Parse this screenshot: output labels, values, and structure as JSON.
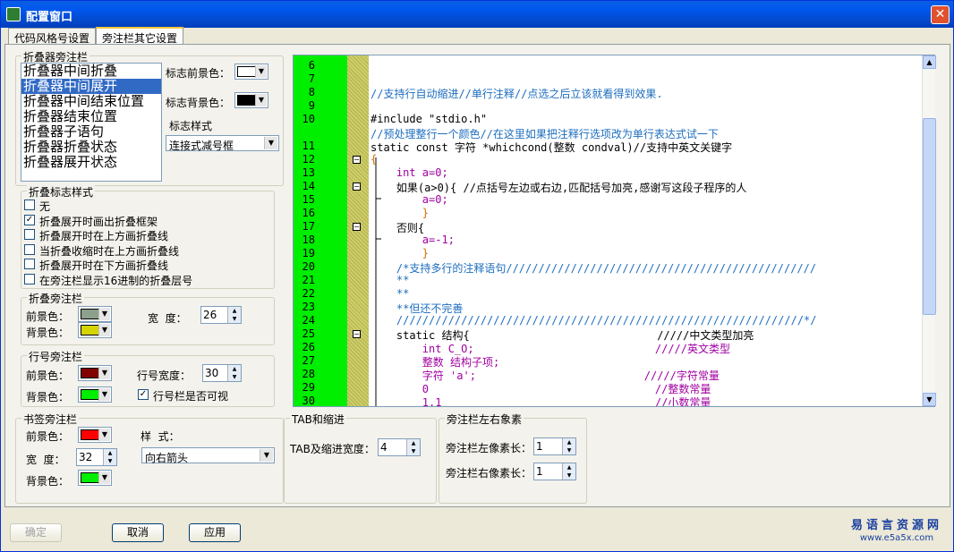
{
  "window": {
    "title": "配置窗口"
  },
  "tabs": [
    "代码风格号设置",
    "旁注栏其它设置"
  ],
  "fold_sidebar": {
    "title": "折叠器旁注栏",
    "items": [
      "折叠器中间折叠",
      "折叠器中间展开",
      "折叠器中间结束位置",
      "折叠器结束位置",
      "折叠器子语句",
      "折叠器折叠状态",
      "折叠器展开状态"
    ],
    "selected": 1,
    "fg_label": "标志前景色：",
    "bg_label": "标志背景色：",
    "style_label": "标志样式",
    "style_value": "连接式减号框",
    "fg_color": "#ffffff",
    "bg_color": "#000000"
  },
  "fold_flag_style": {
    "title": "折叠标志样式",
    "options": [
      {
        "label": "无",
        "checked": false
      },
      {
        "label": "折叠展开时画出折叠框架",
        "checked": true
      },
      {
        "label": "折叠展开时在上方画折叠线",
        "checked": false
      },
      {
        "label": "当折叠收缩时在上方画折叠线",
        "checked": false
      },
      {
        "label": "折叠展开时在下方画折叠线",
        "checked": false
      },
      {
        "label": "在旁注栏显示16进制的折叠层号",
        "checked": false
      }
    ]
  },
  "fold_margin": {
    "title": "折叠旁注栏",
    "fg_label": "前景色：",
    "bg_label": "背景色：",
    "width_label": "宽  度：",
    "width": "26",
    "fg_color": "#8ca08c",
    "bg_color": "#d4d400"
  },
  "line_margin": {
    "title": "行号旁注栏",
    "fg_label": "前景色：",
    "bg_label": "背景色：",
    "width_label": "行号宽度：",
    "width": "30",
    "visible_label": "行号栏是否可视",
    "visible": true,
    "fg_color": "#800000",
    "bg_color": "#00ee00"
  },
  "bookmark_margin": {
    "title": "书签旁注栏",
    "fg_label": "前景色：",
    "width_label": "宽  度：",
    "width": "32",
    "bg_label": "背景色：",
    "style_label": "样  式：",
    "style_value": "向右箭头",
    "fg_color": "#ff0000",
    "bg_color": "#00ee00"
  },
  "tab_indent": {
    "title": "TAB和缩进",
    "width_label": "TAB及缩进宽度：",
    "width": "4"
  },
  "margin_pixels": {
    "title": "旁注栏左右象素",
    "left_label": "旁注栏左像素长：",
    "left": "1",
    "right_label": "旁注栏右像素长：",
    "right": "1"
  },
  "code_lines": [
    {
      "n": "6",
      "t": ""
    },
    {
      "n": "7",
      "t": ""
    },
    {
      "n": "8",
      "t": "//支持行自动缩进//单行注释//点选之后立该就看得到效果."
    },
    {
      "n": "9",
      "t": ""
    },
    {
      "n": "10",
      "t": "#include \"stdio.h\""
    },
    {
      "n": "",
      "t": "//预处理整行一个颜色//在这里如果把注释行选项改为单行表达式试一下"
    },
    {
      "n": "11",
      "t": "static const 字符 *whichcond(整数 condval)//支持中英文关键字"
    },
    {
      "n": "12",
      "t": "{"
    },
    {
      "n": "13",
      "t": "    int a=0;"
    },
    {
      "n": "14",
      "t": "    如果(a>0){ //点括号左边或右边,匹配括号加亮,感谢写这段子程序的人"
    },
    {
      "n": "15",
      "t": "        a=0;"
    },
    {
      "n": "16",
      "t": "        }"
    },
    {
      "n": "17",
      "t": "    否则{"
    },
    {
      "n": "18",
      "t": "        a=-1;"
    },
    {
      "n": "19",
      "t": "        }"
    },
    {
      "n": "20",
      "t": "    /*支持多行的注释语句////////////////////////////////////////////////"
    },
    {
      "n": "21",
      "t": "    **"
    },
    {
      "n": "22",
      "t": "    **"
    },
    {
      "n": "23",
      "t": "    **但还不完善"
    },
    {
      "n": "24",
      "t": "    ///////////////////////////////////////////////////////////////*/"
    },
    {
      "n": "25",
      "t": "    static 结构{                             /////中文类型加亮"
    },
    {
      "n": "26",
      "t": "        int C_O;                            /////英文类型"
    },
    {
      "n": "27",
      "t": "        整数 结构子项;"
    },
    {
      "n": "28",
      "t": "        字符 'a';                          /////字符常量"
    },
    {
      "n": "29",
      "t": "        0                                   //整数常量"
    },
    {
      "n": "30",
      "t": "        1.1                                 //小数常量"
    }
  ],
  "buttons": {
    "ok": "确定",
    "cancel": "取消",
    "apply": "应用"
  },
  "watermark": {
    "name": "易语言资源网",
    "url": "www.e5a5x.com"
  }
}
